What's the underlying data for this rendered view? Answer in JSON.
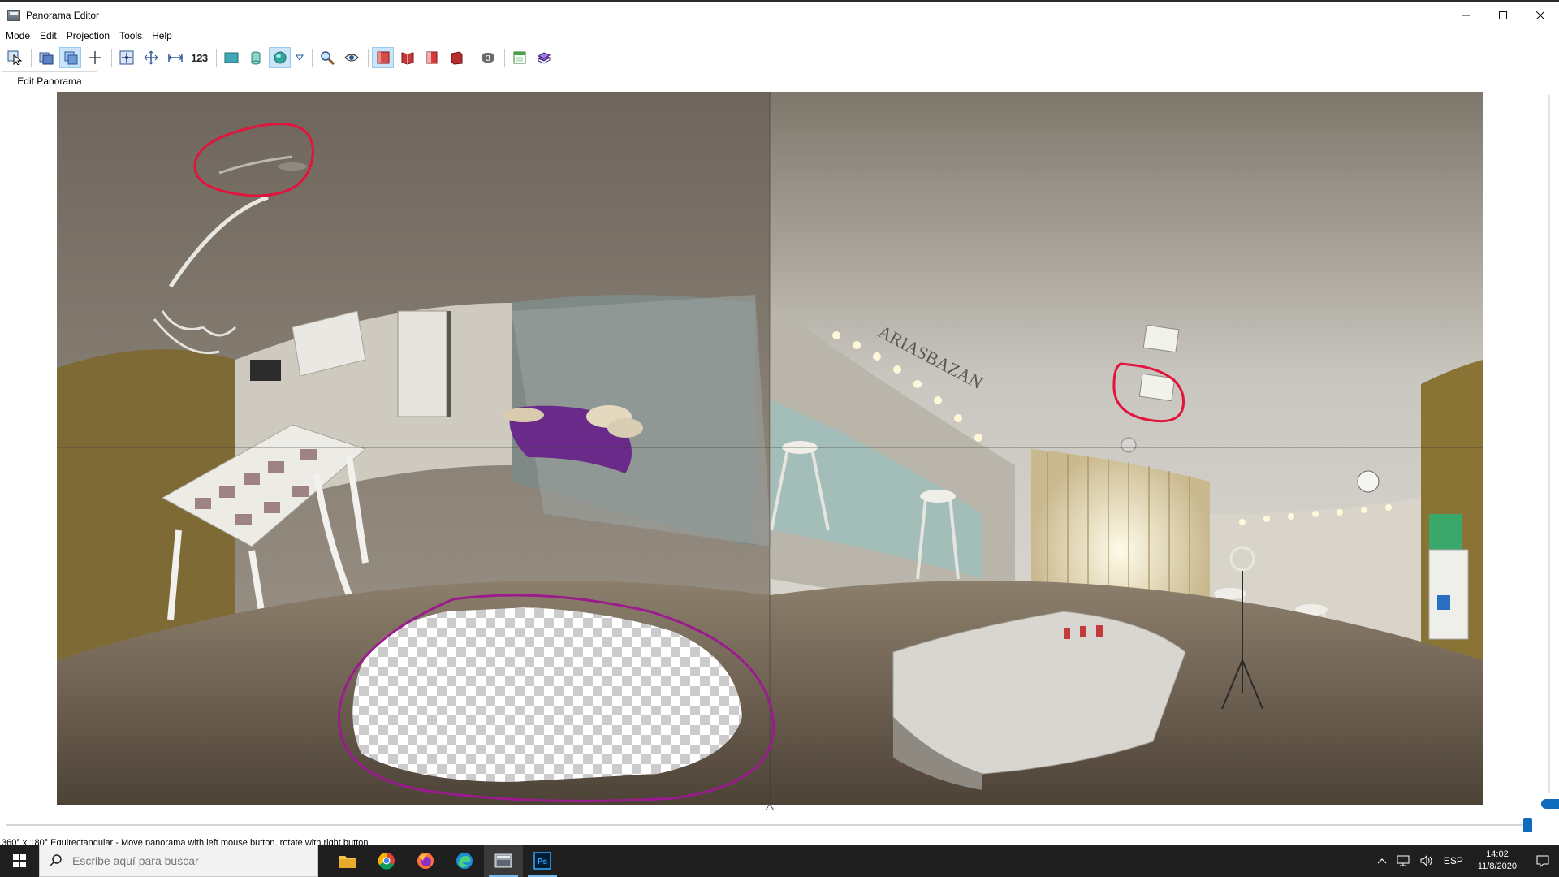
{
  "window": {
    "title": "Panorama Editor",
    "controls": {
      "minimize": "—",
      "maximize": "☐",
      "close": "✕"
    }
  },
  "menu": [
    "Mode",
    "Edit",
    "Projection",
    "Tools",
    "Help"
  ],
  "toolbar": {
    "numbers_label": "123",
    "badge_label": "3"
  },
  "tabs": [
    {
      "label": "Edit Panorama",
      "active": true
    }
  ],
  "canvas": {
    "panorama_description": "equirectangular 360 interior of beauty studio",
    "annotation_colors": {
      "red": "#e0143c",
      "purple": "#9b1b8f"
    },
    "logo_text": "ARIASBAZAN"
  },
  "status": {
    "text": "360° x 180° Equirectangular - Move panorama with left mouse button, rotate with right button"
  },
  "taskbar": {
    "search_placeholder": "Escribe aquí para buscar",
    "apps": [
      "file-explorer",
      "chrome",
      "firefox",
      "edge",
      "panorama-editor",
      "photoshop"
    ],
    "language": "ESP",
    "time": "14:02",
    "date": "11/8/2020"
  },
  "colors": {
    "accent": "#0f6cbd",
    "taskbar": "#1f1f1f"
  }
}
